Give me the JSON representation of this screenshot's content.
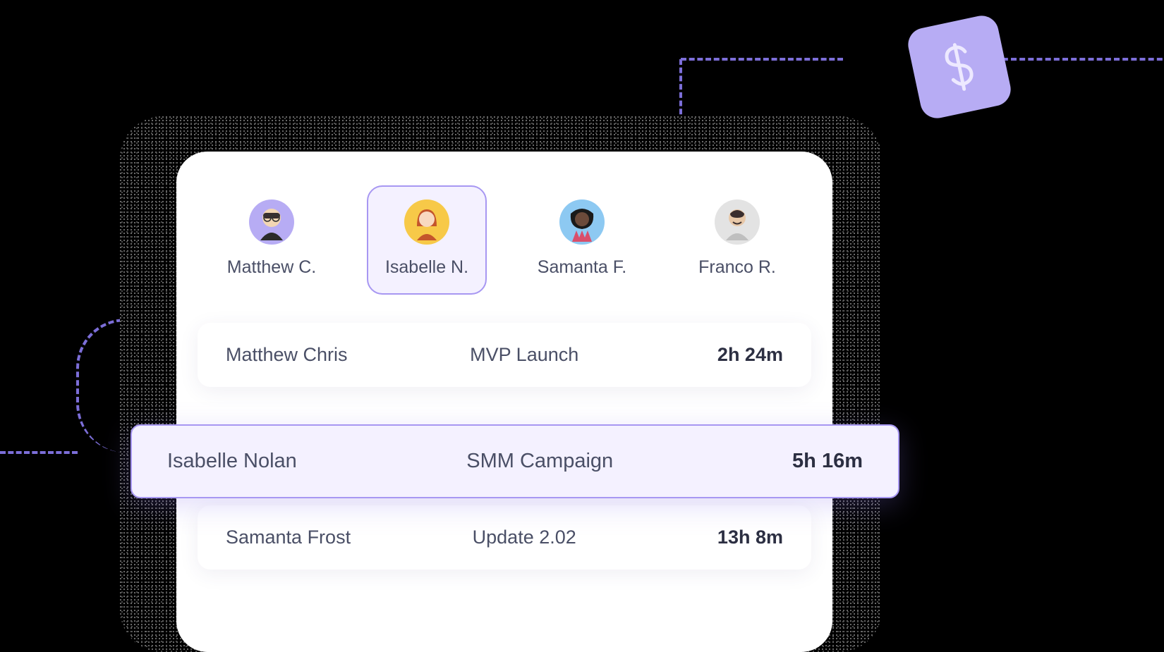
{
  "colors": {
    "accent": "#a797f2",
    "accent_bg": "#f4f1ff",
    "badge_bg": "#b7acf4",
    "text_muted": "#4a4f66",
    "text_strong": "#2c2f42"
  },
  "badge": {
    "icon": "dollar-icon"
  },
  "users": [
    {
      "short_name": "Matthew C.",
      "avatar_bg": "#b7acf4",
      "selected": false
    },
    {
      "short_name": "Isabelle N.",
      "avatar_bg": "#f7c948",
      "selected": true
    },
    {
      "short_name": "Samanta F.",
      "avatar_bg": "#8dc9f2",
      "selected": false
    },
    {
      "short_name": "Franco R.",
      "avatar_bg": "#d9d9d9",
      "selected": false
    }
  ],
  "entries": [
    {
      "name": "Matthew Chris",
      "project": "MVP Launch",
      "time": "2h 24m",
      "highlighted": false
    },
    {
      "name": "Isabelle Nolan",
      "project": "SMM Campaign",
      "time": "5h 16m",
      "highlighted": true
    },
    {
      "name": "Samanta Frost",
      "project": "Update 2.02",
      "time": "13h 8m",
      "highlighted": false
    }
  ]
}
